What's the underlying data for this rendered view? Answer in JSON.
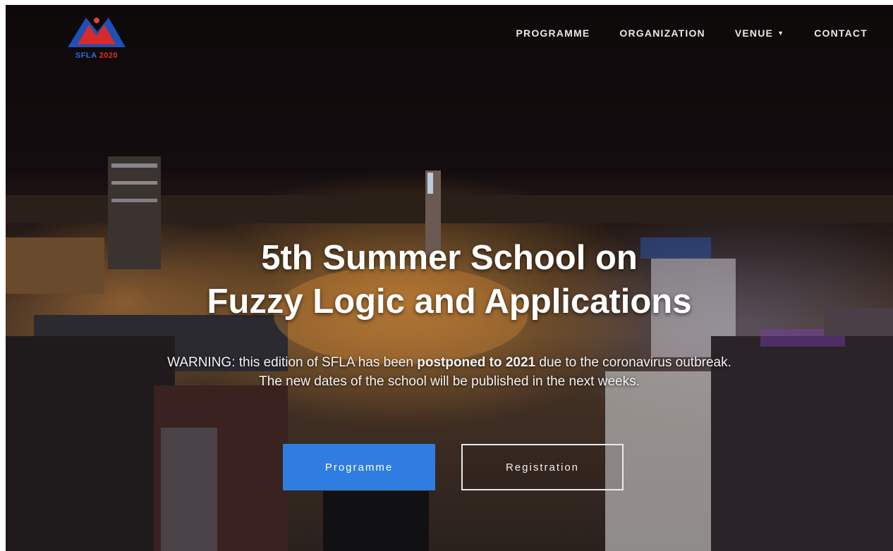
{
  "logo": {
    "text_left": "SFLA",
    "text_right": "2020"
  },
  "nav": {
    "items": [
      {
        "label": "PROGRAMME"
      },
      {
        "label": "ORGANIZATION"
      },
      {
        "label": "VENUE"
      },
      {
        "label": "CONTACT"
      }
    ]
  },
  "hero": {
    "title_line1": "5th Summer School on",
    "title_line2": "Fuzzy Logic and Applications",
    "warning_prefix": "WARNING: this edition of SFLA has been ",
    "warning_bold": "postponed to 2021",
    "warning_suffix": " due to the coronavirus outbreak.",
    "warning_line2": "The new dates of the school will be published in the next weeks."
  },
  "buttons": {
    "primary_label": "Programme",
    "secondary_label": "Registration"
  },
  "colors": {
    "accent": "#2f7de0"
  }
}
